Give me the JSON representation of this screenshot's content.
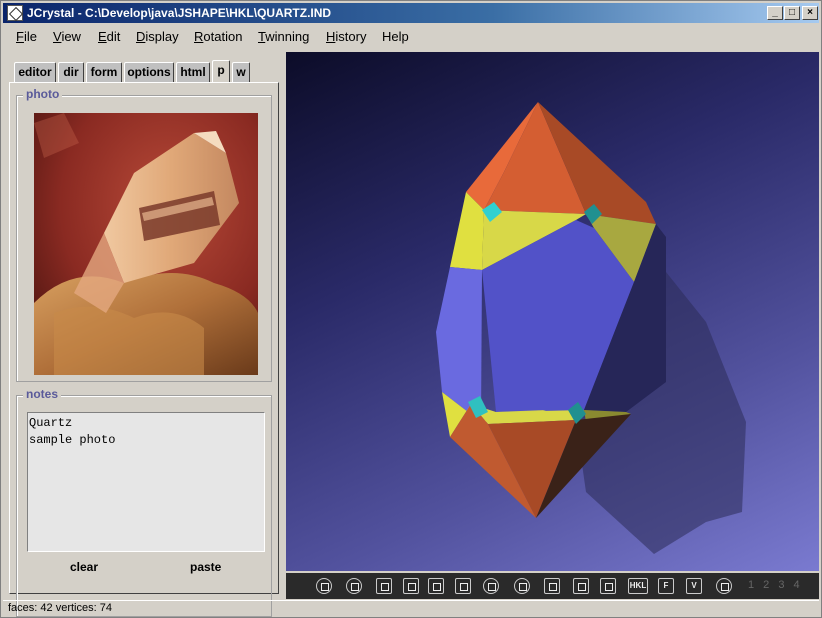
{
  "window": {
    "title": "JCrystal - C:\\Develop\\java\\JSHAPE\\HKL\\QUARTZ.IND"
  },
  "menu": [
    {
      "label": "File",
      "u": "F",
      "rest": "ile"
    },
    {
      "label": "View",
      "u": "V",
      "rest": "iew"
    },
    {
      "label": "Edit",
      "u": "E",
      "rest": "dit"
    },
    {
      "label": "Display",
      "u": "D",
      "rest": "isplay"
    },
    {
      "label": "Rotation",
      "u": "R",
      "rest": "otation"
    },
    {
      "label": "Twinning",
      "u": "T",
      "rest": "winning"
    },
    {
      "label": "History",
      "u": "H",
      "rest": "istory"
    },
    {
      "label": "Help",
      "u": "",
      "rest": "Help"
    }
  ],
  "tabs": [
    "editor",
    "dir",
    "form",
    "options",
    "html",
    "p",
    "w"
  ],
  "active_tab": "p",
  "photo_panel": {
    "legend": "photo"
  },
  "notes_panel": {
    "legend": "notes",
    "text": "Quartz\nsample photo",
    "clear_label": "clear",
    "paste_label": "paste"
  },
  "toolbar": {
    "tools": [
      "rotate-icon",
      "zoom-rotate-icon",
      "fit-icon",
      "box-icon",
      "move-icon",
      "pan-icon",
      "orbit-icon",
      "zoom-icon",
      "twin-icon",
      "frame-icon",
      "shadow-icon",
      "hkl-icon",
      "f-icon",
      "v-icon",
      "print-icon"
    ],
    "hkl": "HKL",
    "f": "F",
    "v": "V",
    "pages": "1 2 3 4"
  },
  "status": {
    "text": "faces: 42  vertices: 74"
  }
}
